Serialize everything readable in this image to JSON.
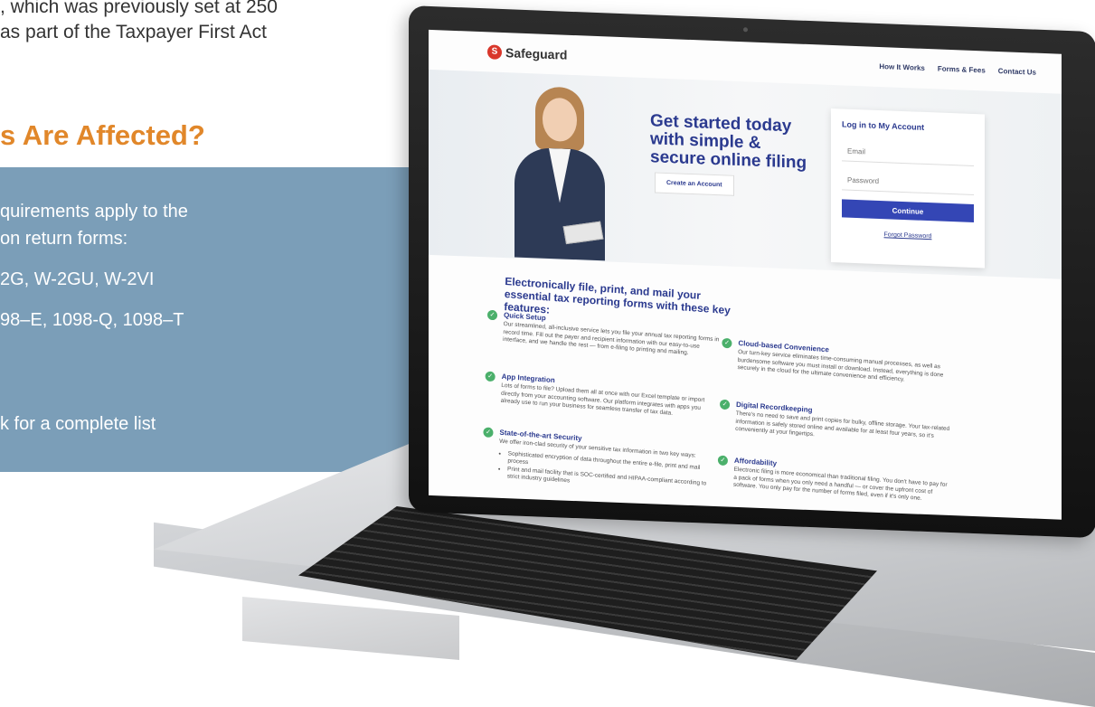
{
  "background": {
    "intro_lines": [
      ", which was previously set at 250",
      "as part of the Taxpayer First Act"
    ],
    "heading": "s Are Affected?",
    "panel_lines": [
      "quirements apply to the",
      "on return forms:",
      "2G, W-2GU, W-2VI",
      "98–E, 1098-Q, 1098–T",
      "k for a complete list"
    ],
    "colors": {
      "heading": "#e1872a",
      "panel": "#7b9eb8"
    }
  },
  "site": {
    "logo_text": "Safeguard",
    "logo_icon": "shield-logo-icon",
    "nav": [
      "How It Works",
      "Forms & Fees",
      "Contact Us"
    ],
    "hero": {
      "title_lines": [
        "Get started today",
        "with simple &",
        "secure online filing"
      ],
      "create_button": "Create an Account"
    },
    "login": {
      "title": "Log in to My Account",
      "email_placeholder": "Email",
      "password_placeholder": "Password",
      "continue": "Continue",
      "forgot": "Forgot Password"
    },
    "features_heading": "Electronically file, print, and mail your essential tax reporting forms with these key features:",
    "features": [
      {
        "title": "Quick Setup",
        "desc": "Our streamlined, all-inclusive service lets you file your annual tax reporting forms in record time. Fill out the payer and recipient information with our easy-to-use interface, and we handle the rest — from e-filing to printing and mailing."
      },
      {
        "title": "App Integration",
        "desc": "Lots of forms to file? Upload them all at once with our Excel template or import directly from your accounting software. Our platform integrates with apps you already use to run your business for seamless transfer of tax data."
      },
      {
        "title": "State-of-the-art Security",
        "desc": "We offer iron-clad security of your sensitive tax information in two key ways:",
        "bullets": [
          "Sophisticated encryption of data throughout the entire e-file, print and mail process",
          "Print and mail facility that is SOC-certified and HIPAA-compliant according to strict industry guidelines"
        ]
      },
      {
        "title": "Cloud-based Convenience",
        "desc": "Our turn-key service eliminates time-consuming manual processes, as well as burdensome software you must install or download. Instead, everything is done securely in the cloud for the ultimate convenience and efficiency."
      },
      {
        "title": "Digital Recordkeeping",
        "desc": "There's no need to save and print copies for bulky, offline storage. Your tax-related information is safely stored online and available for at least four years, so it's conveniently at your fingertips."
      },
      {
        "title": "Affordability",
        "desc": "Electronic filing is more economical than traditional filing. You don't have to pay for a pack of forms when you only need a handful — or cover the upfront cost of software. You only pay for the number of forms filed, even if it's only one."
      }
    ],
    "colors": {
      "brand_blue": "#2b3a8f",
      "button": "#3446b5",
      "check": "#4bb06b",
      "logo": "#d9372b"
    }
  }
}
